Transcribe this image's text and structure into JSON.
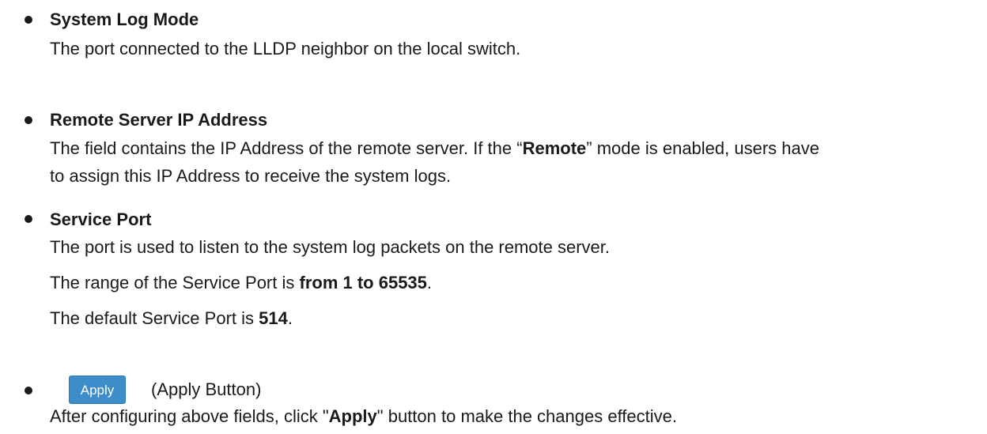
{
  "items": [
    {
      "title": "System Log Mode",
      "lines": [
        "The port connected to the LLDP neighbor on the local switch."
      ]
    },
    {
      "title": "Remote Server IP Address",
      "line1_a": "The field contains the IP Address of the remote server. If the “",
      "line1_b": "Remote",
      "line1_c": "” mode is enabled, users have",
      "line2": "to assign this IP Address to receive the system logs."
    },
    {
      "title": "Service Port",
      "line1": "The port is used to listen to the system log packets on the remote server.",
      "range_a": "The range of the Service Port is ",
      "range_b": "from 1 to 65535",
      "range_c": ".",
      "default_a": "The default Service Port is ",
      "default_b": "514",
      "default_c": "."
    },
    {
      "button_label": "Apply",
      "button_desc": "(Apply Button)",
      "desc_a": "After configuring above fields, click \"",
      "desc_b": "Apply",
      "desc_c": "\" button to make the changes effective."
    }
  ],
  "colors": {
    "text": "#1a1a1a",
    "button_bg": "#3c8dca",
    "button_text": "#ffffff"
  }
}
